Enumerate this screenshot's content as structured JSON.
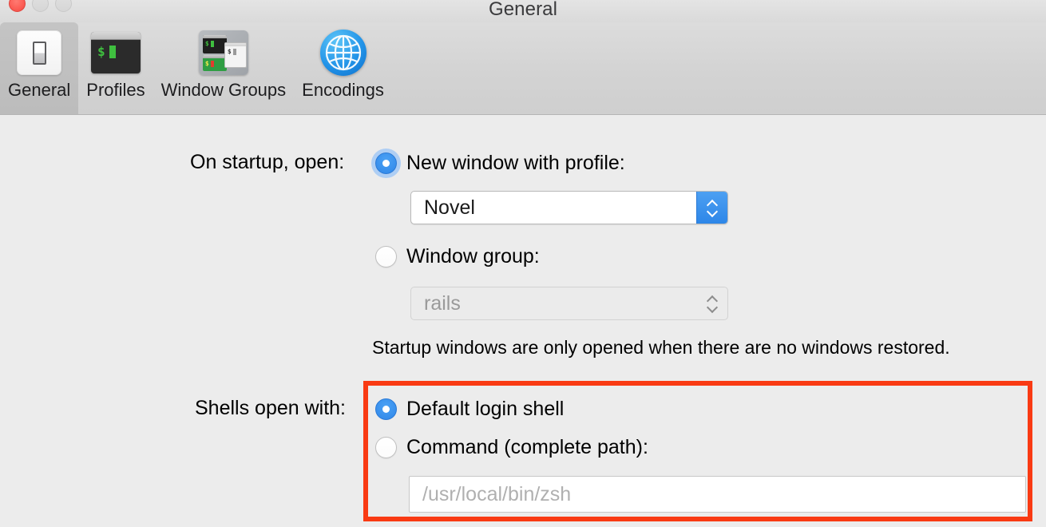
{
  "window": {
    "title": "General",
    "traffic_lights": [
      {
        "name": "close",
        "state": "active",
        "color": "#fc5f57"
      },
      {
        "name": "minimize",
        "state": "disabled",
        "color": "#dcdcdc"
      },
      {
        "name": "zoom",
        "state": "disabled",
        "color": "#dcdcdc"
      }
    ]
  },
  "toolbar": {
    "tabs": [
      {
        "label": "General",
        "icon": "light-switch-icon",
        "selected": true
      },
      {
        "label": "Profiles",
        "icon": "terminal-window-icon",
        "selected": false
      },
      {
        "label": "Window Groups",
        "icon": "window-groups-icon",
        "selected": false
      },
      {
        "label": "Encodings",
        "icon": "globe-icon",
        "selected": false
      }
    ]
  },
  "startup": {
    "label": "On startup, open:",
    "option_new_window": {
      "label": "New window with profile:",
      "selected": true,
      "focused": true
    },
    "profile_combo": {
      "value": "Novel",
      "enabled": true
    },
    "option_window_group": {
      "label": "Window group:",
      "selected": false,
      "focused": false
    },
    "window_group_combo": {
      "value": "rails",
      "enabled": false
    },
    "hint": "Startup windows are only opened when there are no windows restored."
  },
  "shells": {
    "label": "Shells open with:",
    "option_default_login_shell": {
      "label": "Default login shell",
      "selected": true,
      "focused": false
    },
    "option_command": {
      "label": "Command (complete path):",
      "selected": false,
      "focused": false
    },
    "command_field": {
      "value": "",
      "placeholder": "/usr/local/bin/zsh"
    }
  },
  "annotation": {
    "name": "red-highlight-box",
    "color": "#f93a13"
  },
  "icon_glyphs": {
    "dollar": "$"
  }
}
